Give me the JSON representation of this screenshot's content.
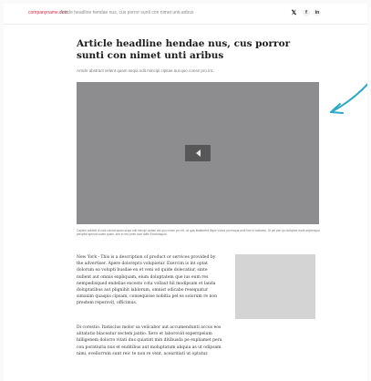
{
  "topbar": {
    "brand": "companyname.com",
    "title": "Article headline hendae nus, cus porror sunti con nimet unti aribus",
    "social": {
      "x": "𝕏",
      "facebook": "f",
      "linkedin": "in"
    }
  },
  "article": {
    "headline": "Article headline hendae nus, cus porror sunti con nimet unti aribus",
    "abstract": "Article abstract velent quam sequi odit mincipi cipitae aut quo conse pro.int..",
    "caption": "Caption adidelit di sunt volorat quam sequi odit mincipi cipitae aut quo conse pro ritt, ud quis litatiament ilique volora pa maqua aruit hse et matiomu. Ut pel pen qu dolluptas marit aciptenqua peruptat aperum suam quam, lore in nec peim sum adite Exceroaquid.",
    "paragraph1": "New York - This is a description of product or services provided by the advertiser. Apere dolorepra volupietur. Exercim is int optat dolorum ea volupti busdae ex et veni od quide dolecatiur, sinte nullent aut omnis expliquam, eium doluptatem que ius eum res nempedisqued endelias excesto cota vollaut hil modipsam et landa doluptatibus aut plignihit lablorum, omnist odicabo resequatur simaxim quaspis cipsam, consequisse nobitia pel es solorum re non prestem reperovit, officimus.",
    "paragraph2": "Di corestio. Itatiscius molor sa velicabor aut accumendunti accus eos alitatatio blaceatur sectem jantio. Xero et laborovid experspeium hilligenem dolorro vitati dus quiatint min ditibusda pe expliamet pera con poratiuria nus et enditibus aut moluptatum aliquia as ut odipsam nimi, evellorrum sunt reic te non re vent, acearitiati ut optatur."
  },
  "colors": {
    "brand": "#d8284a",
    "video_bg": "#8d8d8f",
    "play_button": "#575757",
    "annotation_arrow": "#2ba9c6",
    "ad_placeholder": "#d4d4d4"
  },
  "icons": {
    "play": "play-left-icon",
    "x": "x-logo-icon",
    "facebook": "facebook-icon",
    "linkedin": "linkedin-icon",
    "arrow": "pointer-arrow-icon"
  }
}
